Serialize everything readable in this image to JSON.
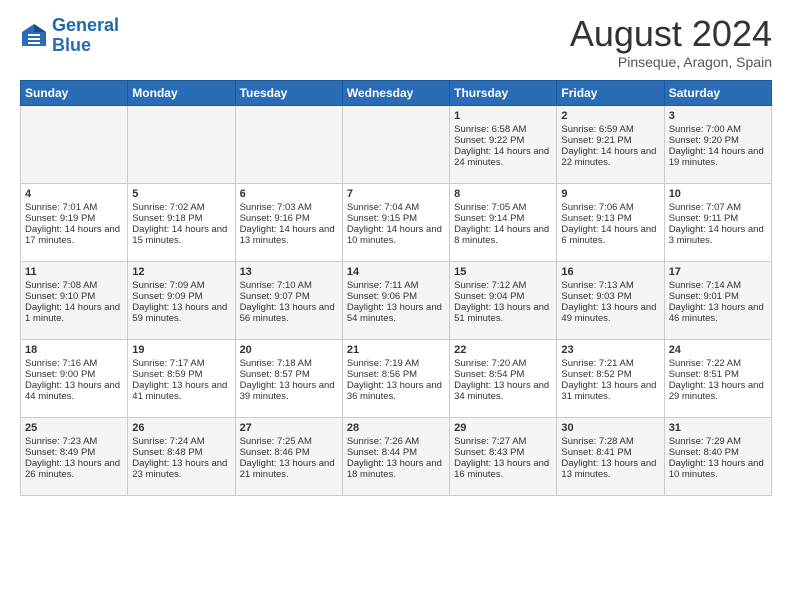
{
  "logo": {
    "line1": "General",
    "line2": "Blue"
  },
  "title": "August 2024",
  "location": "Pinseque, Aragon, Spain",
  "weekdays": [
    "Sunday",
    "Monday",
    "Tuesday",
    "Wednesday",
    "Thursday",
    "Friday",
    "Saturday"
  ],
  "weeks": [
    [
      {
        "day": "",
        "sunrise": "",
        "sunset": "",
        "daylight": ""
      },
      {
        "day": "",
        "sunrise": "",
        "sunset": "",
        "daylight": ""
      },
      {
        "day": "",
        "sunrise": "",
        "sunset": "",
        "daylight": ""
      },
      {
        "day": "",
        "sunrise": "",
        "sunset": "",
        "daylight": ""
      },
      {
        "day": "1",
        "sunrise": "Sunrise: 6:58 AM",
        "sunset": "Sunset: 9:22 PM",
        "daylight": "Daylight: 14 hours and 24 minutes."
      },
      {
        "day": "2",
        "sunrise": "Sunrise: 6:59 AM",
        "sunset": "Sunset: 9:21 PM",
        "daylight": "Daylight: 14 hours and 22 minutes."
      },
      {
        "day": "3",
        "sunrise": "Sunrise: 7:00 AM",
        "sunset": "Sunset: 9:20 PM",
        "daylight": "Daylight: 14 hours and 19 minutes."
      }
    ],
    [
      {
        "day": "4",
        "sunrise": "Sunrise: 7:01 AM",
        "sunset": "Sunset: 9:19 PM",
        "daylight": "Daylight: 14 hours and 17 minutes."
      },
      {
        "day": "5",
        "sunrise": "Sunrise: 7:02 AM",
        "sunset": "Sunset: 9:18 PM",
        "daylight": "Daylight: 14 hours and 15 minutes."
      },
      {
        "day": "6",
        "sunrise": "Sunrise: 7:03 AM",
        "sunset": "Sunset: 9:16 PM",
        "daylight": "Daylight: 14 hours and 13 minutes."
      },
      {
        "day": "7",
        "sunrise": "Sunrise: 7:04 AM",
        "sunset": "Sunset: 9:15 PM",
        "daylight": "Daylight: 14 hours and 10 minutes."
      },
      {
        "day": "8",
        "sunrise": "Sunrise: 7:05 AM",
        "sunset": "Sunset: 9:14 PM",
        "daylight": "Daylight: 14 hours and 8 minutes."
      },
      {
        "day": "9",
        "sunrise": "Sunrise: 7:06 AM",
        "sunset": "Sunset: 9:13 PM",
        "daylight": "Daylight: 14 hours and 6 minutes."
      },
      {
        "day": "10",
        "sunrise": "Sunrise: 7:07 AM",
        "sunset": "Sunset: 9:11 PM",
        "daylight": "Daylight: 14 hours and 3 minutes."
      }
    ],
    [
      {
        "day": "11",
        "sunrise": "Sunrise: 7:08 AM",
        "sunset": "Sunset: 9:10 PM",
        "daylight": "Daylight: 14 hours and 1 minute."
      },
      {
        "day": "12",
        "sunrise": "Sunrise: 7:09 AM",
        "sunset": "Sunset: 9:09 PM",
        "daylight": "Daylight: 13 hours and 59 minutes."
      },
      {
        "day": "13",
        "sunrise": "Sunrise: 7:10 AM",
        "sunset": "Sunset: 9:07 PM",
        "daylight": "Daylight: 13 hours and 56 minutes."
      },
      {
        "day": "14",
        "sunrise": "Sunrise: 7:11 AM",
        "sunset": "Sunset: 9:06 PM",
        "daylight": "Daylight: 13 hours and 54 minutes."
      },
      {
        "day": "15",
        "sunrise": "Sunrise: 7:12 AM",
        "sunset": "Sunset: 9:04 PM",
        "daylight": "Daylight: 13 hours and 51 minutes."
      },
      {
        "day": "16",
        "sunrise": "Sunrise: 7:13 AM",
        "sunset": "Sunset: 9:03 PM",
        "daylight": "Daylight: 13 hours and 49 minutes."
      },
      {
        "day": "17",
        "sunrise": "Sunrise: 7:14 AM",
        "sunset": "Sunset: 9:01 PM",
        "daylight": "Daylight: 13 hours and 46 minutes."
      }
    ],
    [
      {
        "day": "18",
        "sunrise": "Sunrise: 7:16 AM",
        "sunset": "Sunset: 9:00 PM",
        "daylight": "Daylight: 13 hours and 44 minutes."
      },
      {
        "day": "19",
        "sunrise": "Sunrise: 7:17 AM",
        "sunset": "Sunset: 8:59 PM",
        "daylight": "Daylight: 13 hours and 41 minutes."
      },
      {
        "day": "20",
        "sunrise": "Sunrise: 7:18 AM",
        "sunset": "Sunset: 8:57 PM",
        "daylight": "Daylight: 13 hours and 39 minutes."
      },
      {
        "day": "21",
        "sunrise": "Sunrise: 7:19 AM",
        "sunset": "Sunset: 8:56 PM",
        "daylight": "Daylight: 13 hours and 36 minutes."
      },
      {
        "day": "22",
        "sunrise": "Sunrise: 7:20 AM",
        "sunset": "Sunset: 8:54 PM",
        "daylight": "Daylight: 13 hours and 34 minutes."
      },
      {
        "day": "23",
        "sunrise": "Sunrise: 7:21 AM",
        "sunset": "Sunset: 8:52 PM",
        "daylight": "Daylight: 13 hours and 31 minutes."
      },
      {
        "day": "24",
        "sunrise": "Sunrise: 7:22 AM",
        "sunset": "Sunset: 8:51 PM",
        "daylight": "Daylight: 13 hours and 29 minutes."
      }
    ],
    [
      {
        "day": "25",
        "sunrise": "Sunrise: 7:23 AM",
        "sunset": "Sunset: 8:49 PM",
        "daylight": "Daylight: 13 hours and 26 minutes."
      },
      {
        "day": "26",
        "sunrise": "Sunrise: 7:24 AM",
        "sunset": "Sunset: 8:48 PM",
        "daylight": "Daylight: 13 hours and 23 minutes."
      },
      {
        "day": "27",
        "sunrise": "Sunrise: 7:25 AM",
        "sunset": "Sunset: 8:46 PM",
        "daylight": "Daylight: 13 hours and 21 minutes."
      },
      {
        "day": "28",
        "sunrise": "Sunrise: 7:26 AM",
        "sunset": "Sunset: 8:44 PM",
        "daylight": "Daylight: 13 hours and 18 minutes."
      },
      {
        "day": "29",
        "sunrise": "Sunrise: 7:27 AM",
        "sunset": "Sunset: 8:43 PM",
        "daylight": "Daylight: 13 hours and 16 minutes."
      },
      {
        "day": "30",
        "sunrise": "Sunrise: 7:28 AM",
        "sunset": "Sunset: 8:41 PM",
        "daylight": "Daylight: 13 hours and 13 minutes."
      },
      {
        "day": "31",
        "sunrise": "Sunrise: 7:29 AM",
        "sunset": "Sunset: 8:40 PM",
        "daylight": "Daylight: 13 hours and 10 minutes."
      }
    ]
  ]
}
